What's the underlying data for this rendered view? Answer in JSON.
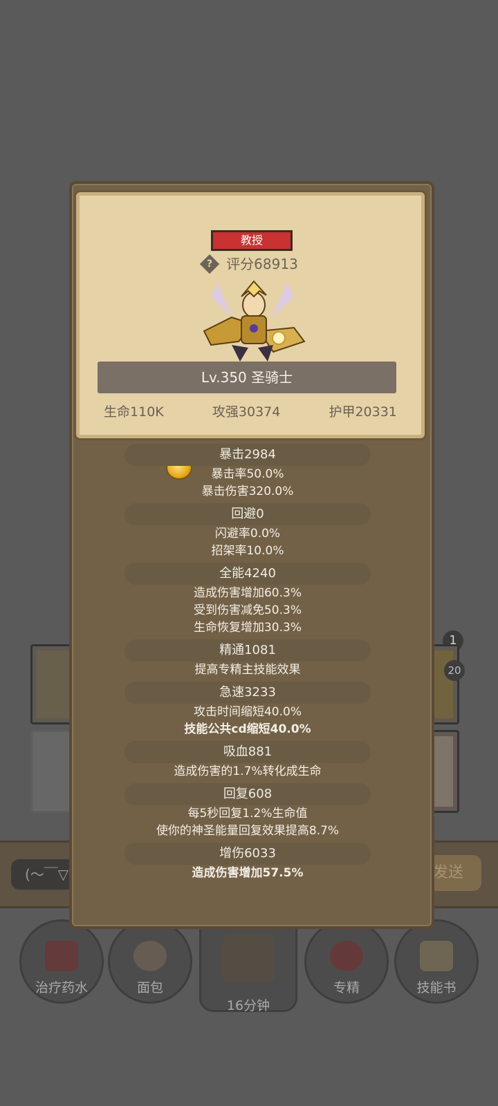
{
  "background": {
    "notification_count": "1",
    "item_count": "20",
    "chat_placeholder": "(～￣▽",
    "send_label": "发送"
  },
  "bottom_bar": [
    {
      "label": "治疗药水",
      "icon": "potion-icon"
    },
    {
      "label": "面包",
      "icon": "bread-icon"
    },
    {
      "label": "16分钟",
      "icon": "chest-icon"
    },
    {
      "label": "专精",
      "icon": "specialization-icon"
    },
    {
      "label": "技能书",
      "icon": "skill-book-icon"
    }
  ],
  "character": {
    "title_badge": "教授",
    "rating": "评分68913",
    "level_class": "Lv.350 圣骑士",
    "hp": "生命110K",
    "attack": "攻强30374",
    "armor": "护甲20331"
  },
  "stats": [
    {
      "head": "暴击2984",
      "lines": [
        "暴击率50.0%",
        "暴击伤害320.0%"
      ]
    },
    {
      "head": "回避0",
      "lines": [
        "闪避率0.0%",
        "招架率10.0%"
      ]
    },
    {
      "head": "全能4240",
      "lines": [
        "造成伤害增加60.3%",
        "受到伤害减免50.3%",
        "生命恢复增加30.3%"
      ]
    },
    {
      "head": "精通1081",
      "lines": [
        "提高专精主技能效果"
      ]
    },
    {
      "head": "急速3233",
      "lines": [
        "攻击时间缩短40.0%",
        "技能公共cd缩短40.0%"
      ]
    },
    {
      "head": "吸血881",
      "lines": [
        "造成伤害的1.7%转化成生命"
      ]
    },
    {
      "head": "回复608",
      "lines": [
        "每5秒回复1.2%生命值",
        "使你的神圣能量回复效果提高8.7%"
      ]
    },
    {
      "head": "增伤6033",
      "lines": [
        "造成伤害增加57.5%"
      ]
    }
  ],
  "colors": {
    "popup_bg": "#736147",
    "parchment": "#e6d2a7",
    "title_badge": "#c83232"
  }
}
